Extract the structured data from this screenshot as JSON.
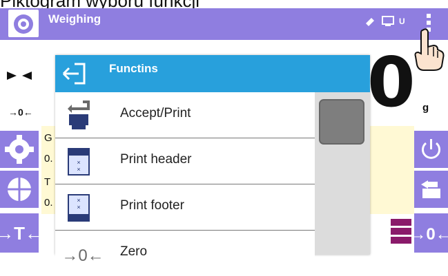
{
  "caption": "Piktogram wyboru funkcji",
  "header": {
    "title": "Weighing",
    "status": "⁄ ⊏ U"
  },
  "display": {
    "value": "0",
    "unit": "g",
    "zero_marker": "→0←"
  },
  "info": {
    "rows": [
      {
        "label": "G",
        "value": "0."
      },
      {
        "label": "T",
        "value": "0."
      }
    ]
  },
  "functions": {
    "title": "Functins",
    "items": [
      {
        "label": "Accept/Print",
        "icon": "printer-icon"
      },
      {
        "label": "Print header",
        "icon": "print-header-icon"
      },
      {
        "label": "Print footer",
        "icon": "print-footer-icon"
      },
      {
        "label": "Zero",
        "icon": "zero-icon"
      }
    ]
  },
  "left_buttons": [
    "settings-gear",
    "tare-database",
    "tare"
  ],
  "right_buttons": [
    "power",
    "print",
    "zero"
  ],
  "colors": {
    "topbar": "#8f7ee0",
    "header": "#28a0dc",
    "scroll_thumb": "#7e7e7e"
  }
}
